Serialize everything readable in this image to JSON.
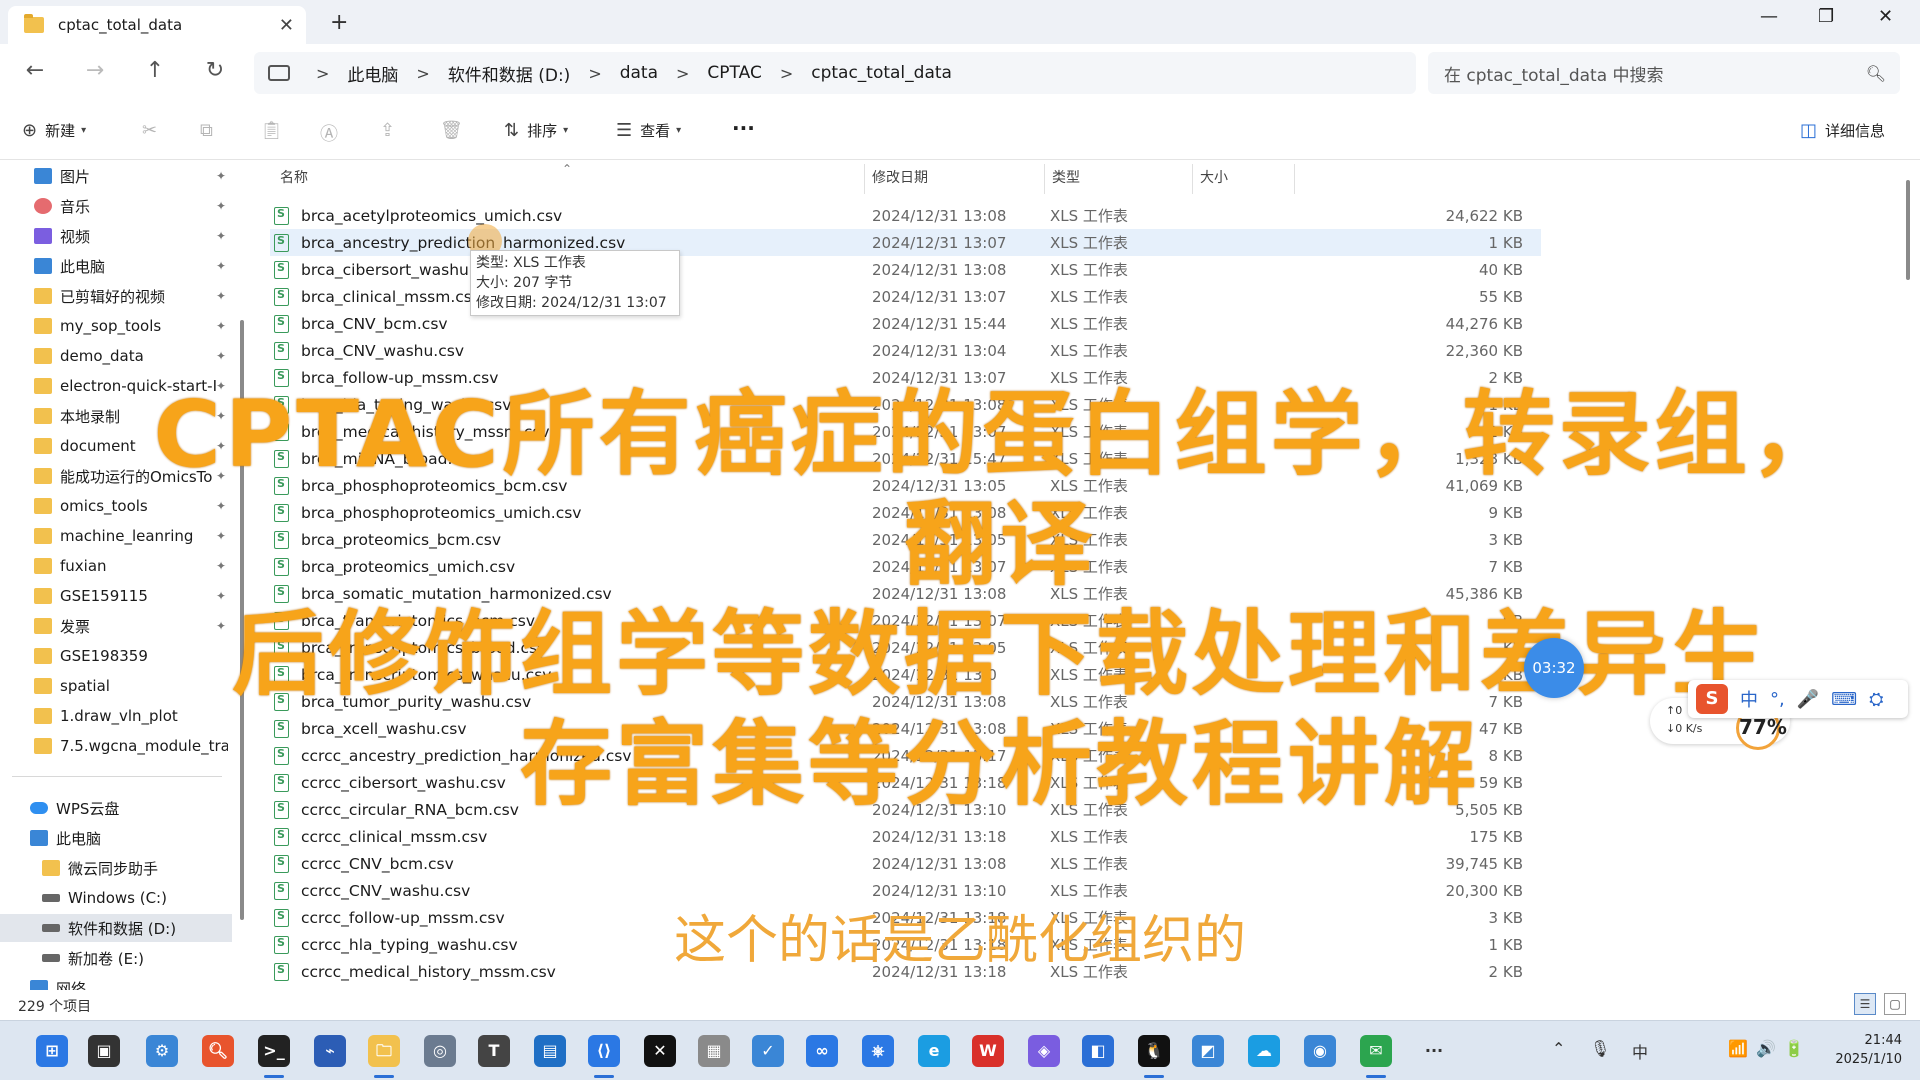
{
  "window": {
    "tab_title": "cptac_total_data",
    "tab_close": "✕",
    "new_tab": "+",
    "minimize": "—",
    "maximize": "❐",
    "close": "✕"
  },
  "nav": {
    "back": "←",
    "forward": "→",
    "up": "↑",
    "refresh": "↻"
  },
  "breadcrumb": [
    "此电脑",
    "软件和数据 (D:)",
    "data",
    "CPTAC",
    "cptac_total_data"
  ],
  "breadcrumb_sep": ">",
  "search": {
    "placeholder": "在 cptac_total_data 中搜索"
  },
  "toolbar": {
    "new_label": "新建",
    "sort_label": "排序",
    "view_label": "查看",
    "more_label": "···",
    "details_label": "详细信息"
  },
  "sidebar": {
    "items": [
      {
        "label": "图片",
        "icon": "pictures-icon",
        "pinned": true
      },
      {
        "label": "音乐",
        "icon": "music-icon",
        "pinned": true
      },
      {
        "label": "视频",
        "icon": "videos-icon",
        "pinned": true
      },
      {
        "label": "此电脑",
        "icon": "computer-icon",
        "pinned": true
      },
      {
        "label": "已剪辑好的视频",
        "icon": "folder-icon",
        "pinned": true
      },
      {
        "label": "my_sop_tools",
        "icon": "folder-icon",
        "pinned": true
      },
      {
        "label": "demo_data",
        "icon": "folder-icon",
        "pinned": true
      },
      {
        "label": "electron-quick-start-I",
        "icon": "folder-icon",
        "pinned": true
      },
      {
        "label": "本地录制",
        "icon": "folder-icon",
        "pinned": true
      },
      {
        "label": "document",
        "icon": "folder-icon",
        "pinned": true
      },
      {
        "label": "能成功运行的OmicsTo",
        "icon": "folder-icon",
        "pinned": true
      },
      {
        "label": "omics_tools",
        "icon": "folder-icon",
        "pinned": true
      },
      {
        "label": "machine_leanring",
        "icon": "folder-icon",
        "pinned": true
      },
      {
        "label": "fuxian",
        "icon": "folder-icon",
        "pinned": true
      },
      {
        "label": "GSE159115",
        "icon": "folder-icon",
        "pinned": true
      },
      {
        "label": "发票",
        "icon": "folder-icon",
        "pinned": true
      },
      {
        "label": "GSE198359",
        "icon": "folder-icon",
        "pinned": false
      },
      {
        "label": "spatial",
        "icon": "folder-icon",
        "pinned": false
      },
      {
        "label": "1.draw_vln_plot",
        "icon": "folder-icon",
        "pinned": false
      },
      {
        "label": "7.5.wgcna_module_trait",
        "icon": "folder-icon",
        "pinned": false
      }
    ],
    "tree": [
      {
        "label": "WPS云盘",
        "icon": "cloud-icon",
        "indent": 0
      },
      {
        "label": "此电脑",
        "icon": "computer-icon",
        "indent": 0
      },
      {
        "label": "微云同步助手",
        "icon": "folder-icon",
        "indent": 1
      },
      {
        "label": "Windows (C:)",
        "icon": "drive-icon",
        "indent": 1
      },
      {
        "label": "软件和数据 (D:)",
        "icon": "drive-icon",
        "indent": 1,
        "selected": true
      },
      {
        "label": "新加卷 (E:)",
        "icon": "drive-icon",
        "indent": 1
      },
      {
        "label": "网络",
        "icon": "network-icon",
        "indent": 0
      }
    ],
    "pin_glyph": "📌"
  },
  "columns": {
    "name": "名称",
    "date": "修改日期",
    "type": "类型",
    "size": "大小"
  },
  "files": [
    {
      "name": "brca_acetylproteomics_umich.csv",
      "date": "2024/12/31 13:08",
      "type": "XLS 工作表",
      "size": "24,622 KB"
    },
    {
      "name": "brca_ancestry_prediction_harmonized.csv",
      "date": "2024/12/31 13:07",
      "type": "XLS 工作表",
      "size": "1 KB"
    },
    {
      "name": "brca_cibersort_washu.csv",
      "date": "2024/12/31 13:08",
      "type": "XLS 工作表",
      "size": "40 KB"
    },
    {
      "name": "brca_clinical_mssm.csv",
      "date": "2024/12/31 13:07",
      "type": "XLS 工作表",
      "size": "55 KB"
    },
    {
      "name": "brca_CNV_bcm.csv",
      "date": "2024/12/31 15:44",
      "type": "XLS 工作表",
      "size": "44,276 KB"
    },
    {
      "name": "brca_CNV_washu.csv",
      "date": "2024/12/31 13:04",
      "type": "XLS 工作表",
      "size": "22,360 KB"
    },
    {
      "name": "brca_follow-up_mssm.csv",
      "date": "2024/12/31 13:07",
      "type": "XLS 工作表",
      "size": "2 KB"
    },
    {
      "name": "brca_hla_typing_washu.csv",
      "date": "2024/12/31 13:08",
      "type": "XLS 工作表",
      "size": "1 KB"
    },
    {
      "name": "brca_medical_history_mssm.csv",
      "date": "2024/12/31 13:07",
      "type": "XLS 工作表",
      "size": "2 KB"
    },
    {
      "name": "brca_miRNA_broad.csv",
      "date": "2024/12/31 15:47",
      "type": "XLS 工作表",
      "size": "1,328 KB"
    },
    {
      "name": "brca_phosphoproteomics_bcm.csv",
      "date": "2024/12/31 13:05",
      "type": "XLS 工作表",
      "size": "41,069 KB"
    },
    {
      "name": "brca_phosphoproteomics_umich.csv",
      "date": "2024/12/31 13:08",
      "type": "XLS 工作表",
      "size": "9 KB"
    },
    {
      "name": "brca_proteomics_bcm.csv",
      "date": "2024/12/31 13:05",
      "type": "XLS 工作表",
      "size": "3 KB"
    },
    {
      "name": "brca_proteomics_umich.csv",
      "date": "2024/12/31 13:07",
      "type": "XLS 工作表",
      "size": "7 KB"
    },
    {
      "name": "brca_somatic_mutation_harmonized.csv",
      "date": "2024/12/31 13:08",
      "type": "XLS 工作表",
      "size": "45,386 KB"
    },
    {
      "name": "brca_transcriptomics_bcm.csv",
      "date": "2024/12/31 13:07",
      "type": "XLS 工作表",
      "size": "KB"
    },
    {
      "name": "brca_transcriptomics_broad.csv",
      "date": "2024/12/31 13:05",
      "type": "XLS 工作表",
      "size": "KB"
    },
    {
      "name": "brca_transcriptomics_washu.csv",
      "date": "2024/12/31 13:0",
      "type": "XLS 工作表",
      "size": "KB"
    },
    {
      "name": "brca_tumor_purity_washu.csv",
      "date": "2024/12/31 13:08",
      "type": "XLS 工作表",
      "size": "7 KB"
    },
    {
      "name": "brca_xcell_washu.csv",
      "date": "2024/12/31 13:08",
      "type": "XLS 工作表",
      "size": "47 KB"
    },
    {
      "name": "ccrcc_ancestry_prediction_harmonized.csv",
      "date": "2024/12/31 13:17",
      "type": "XLS 工作表",
      "size": "8 KB"
    },
    {
      "name": "ccrcc_cibersort_washu.csv",
      "date": "2024/12/31 13:18",
      "type": "XLS 工作表",
      "size": "59 KB"
    },
    {
      "name": "ccrcc_circular_RNA_bcm.csv",
      "date": "2024/12/31 13:10",
      "type": "XLS 工作表",
      "size": "5,505 KB"
    },
    {
      "name": "ccrcc_clinical_mssm.csv",
      "date": "2024/12/31 13:18",
      "type": "XLS 工作表",
      "size": "175 KB"
    },
    {
      "name": "ccrcc_CNV_bcm.csv",
      "date": "2024/12/31 13:08",
      "type": "XLS 工作表",
      "size": "39,745 KB"
    },
    {
      "name": "ccrcc_CNV_washu.csv",
      "date": "2024/12/31 13:10",
      "type": "XLS 工作表",
      "size": "20,300 KB"
    },
    {
      "name": "ccrcc_follow-up_mssm.csv",
      "date": "2024/12/31 13:18",
      "type": "XLS 工作表",
      "size": "3 KB"
    },
    {
      "name": "ccrcc_hla_typing_washu.csv",
      "date": "2024/12/31 13:18",
      "type": "XLS 工作表",
      "size": "1 KB"
    },
    {
      "name": "ccrcc_medical_history_mssm.csv",
      "date": "2024/12/31 13:18",
      "type": "XLS 工作表",
      "size": "2 KB"
    }
  ],
  "tooltip": {
    "type": "类型: XLS 工作表",
    "size": "大小: 207 字节",
    "modified": "修改日期: 2024/12/31 13:07"
  },
  "status": {
    "count": "229 个项目"
  },
  "overlay": {
    "title_line1": "CPTAC所有癌症的蛋白组学，转录组，翻译",
    "title_line2": "后修饰组学等数据下载处理和差异生",
    "title_line3": "存富集等分析教程讲解",
    "subtitle": "这个的话是乙酰化组织的",
    "timer": "03:32"
  },
  "ime": {
    "logo": "S",
    "mode": "中",
    "punct": "°,",
    "mic": "🎤",
    "keyboard": "⌨",
    "toolbox": "⛭"
  },
  "netmon": {
    "up": "↑0",
    "down": "↓0  K/s",
    "percent": "77%"
  },
  "clock": {
    "time": "21:44",
    "date": "2025/1/10"
  },
  "tray": {
    "chevron": "⌃",
    "mic": "🎙",
    "ime": "中",
    "wifi": "📶",
    "volume": "🔊",
    "battery": "🔋"
  },
  "colors": {
    "overlay": "#f7a41a",
    "accent": "#2b6fd6",
    "hover_row": "#e6f0fb"
  }
}
